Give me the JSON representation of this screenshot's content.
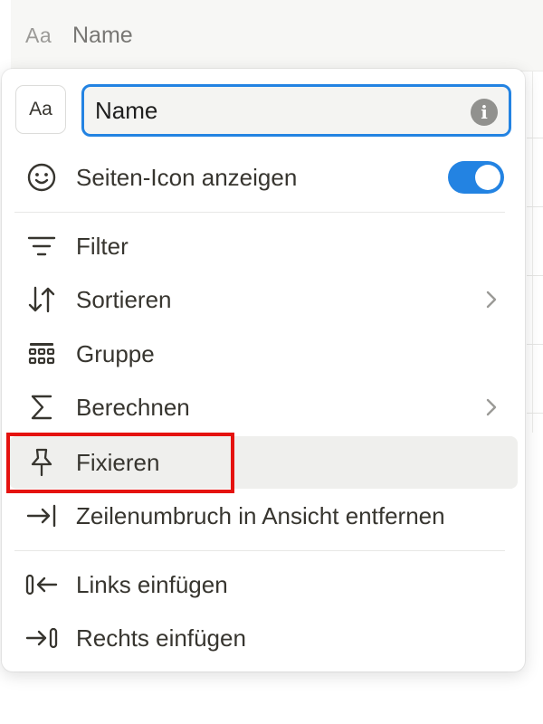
{
  "table": {
    "column_icon": "Aa",
    "column_name": "Name"
  },
  "menu": {
    "type_icon": "Aa",
    "name_value": "Name",
    "info_icon": "i",
    "show_page_icon": {
      "label": "Seiten-Icon anzeigen",
      "enabled": true
    },
    "items": [
      {
        "label": "Filter",
        "icon": "filter-icon"
      },
      {
        "label": "Sortieren",
        "icon": "sort-icon",
        "submenu": true
      },
      {
        "label": "Gruppe",
        "icon": "group-icon"
      },
      {
        "label": "Berechnen",
        "icon": "sum-icon",
        "submenu": true
      },
      {
        "label": "Fixieren",
        "icon": "pin-icon",
        "highlighted": true
      },
      {
        "label": "Zeilenumbruch in Ansicht entfernen",
        "icon": "wrap-icon"
      }
    ],
    "insert_items": [
      {
        "label": "Links einfügen",
        "icon": "insert-left-icon"
      },
      {
        "label": "Rechts einfügen",
        "icon": "insert-right-icon"
      }
    ]
  },
  "colors": {
    "accent": "#2383e2",
    "highlight_box": "#e5120f",
    "hover_bg": "#efefed"
  }
}
